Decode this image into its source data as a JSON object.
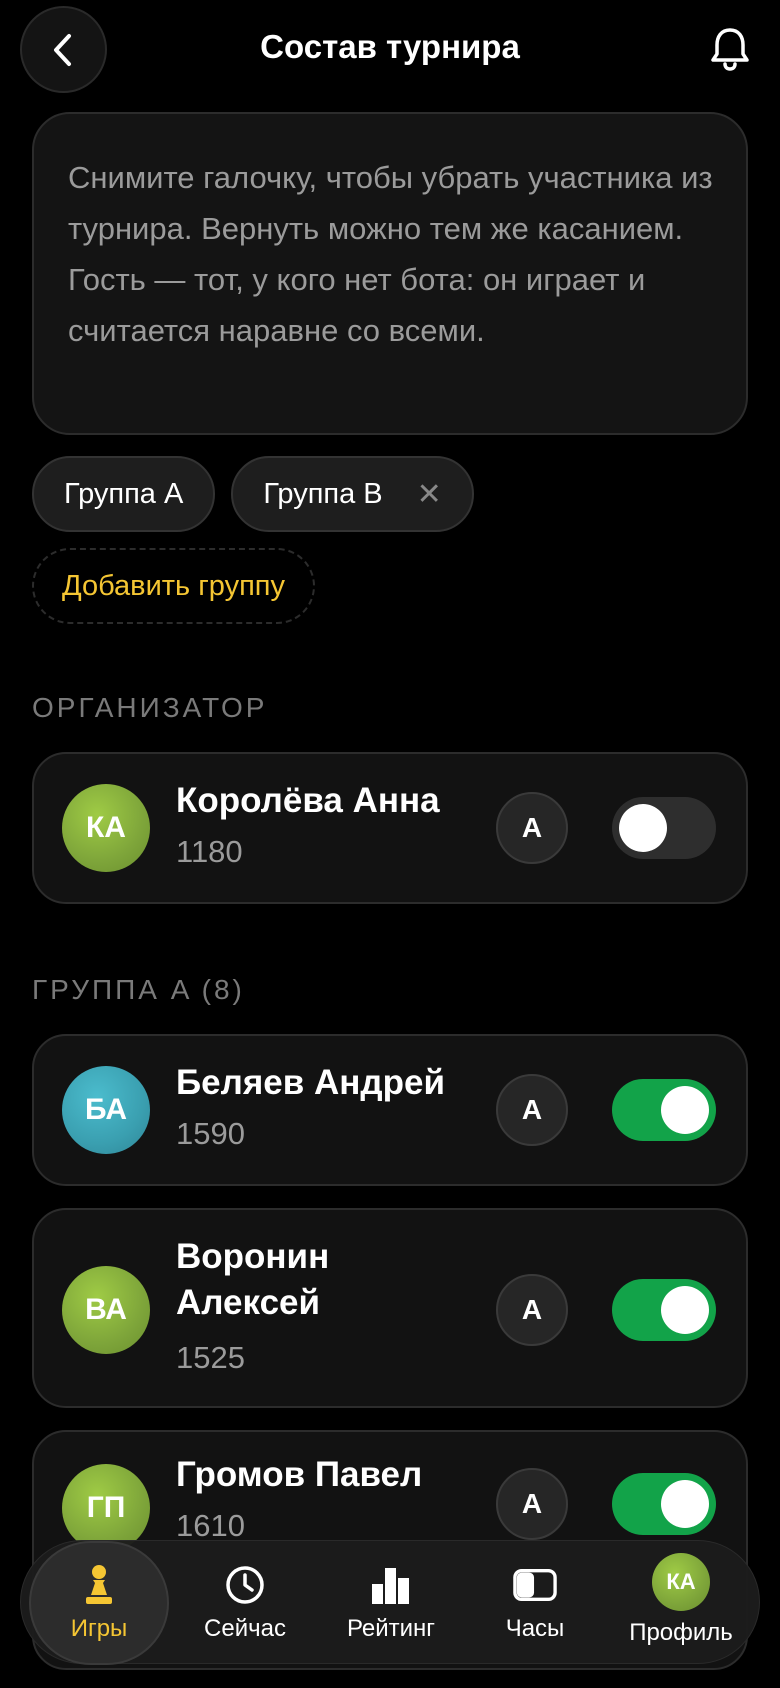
{
  "header": {
    "title": "Состав турнира",
    "back_icon": "chevron-left-icon",
    "bell_icon": "bell-icon"
  },
  "info": {
    "text": "Снимите галочку, чтобы убрать участника из турнира. Вернуть можно тем же касанием. Гость — тот, у кого нет бота: он играет и считается наравне со всеми."
  },
  "groups": {
    "chips": [
      {
        "label": "Группа A"
      },
      {
        "label": "Группа B",
        "remove": "✕"
      }
    ],
    "add_label": "Добавить группу"
  },
  "organizer": {
    "section_label": "ОРГАНИЗАТОР",
    "player": {
      "initials": "КА",
      "name": "Королёва Анна",
      "rating": "1180",
      "group": "A",
      "enabled": false
    }
  },
  "group_a": {
    "section_label": "ГРУППА A (8)",
    "players": [
      {
        "initials": "БА",
        "name": "Беляев Андрей",
        "rating": "1590",
        "group": "A",
        "enabled": true,
        "avatar_color": "#3a9fb0"
      },
      {
        "initials": "ВА",
        "name": "Воронин Алексей",
        "rating": "1525",
        "group": "A",
        "enabled": true,
        "avatar_color": "#7ea53a"
      },
      {
        "initials": "ГП",
        "name": "Громов Павел",
        "rating": "1610",
        "group": "A",
        "enabled": true,
        "avatar_color": "#7ea53a"
      }
    ]
  },
  "nav": {
    "tabs": [
      {
        "label": "Игры",
        "icon": "pawn-icon",
        "active": true
      },
      {
        "label": "Сейчас",
        "icon": "clock-icon"
      },
      {
        "label": "Рейтинг",
        "icon": "bar-chart-icon"
      },
      {
        "label": "Часы",
        "icon": "chess-clock-icon"
      },
      {
        "label": "Профиль",
        "initials": "КА"
      }
    ]
  },
  "colors": {
    "accent": "#f5c633",
    "toggle_on": "#12a349",
    "background": "#000000"
  }
}
